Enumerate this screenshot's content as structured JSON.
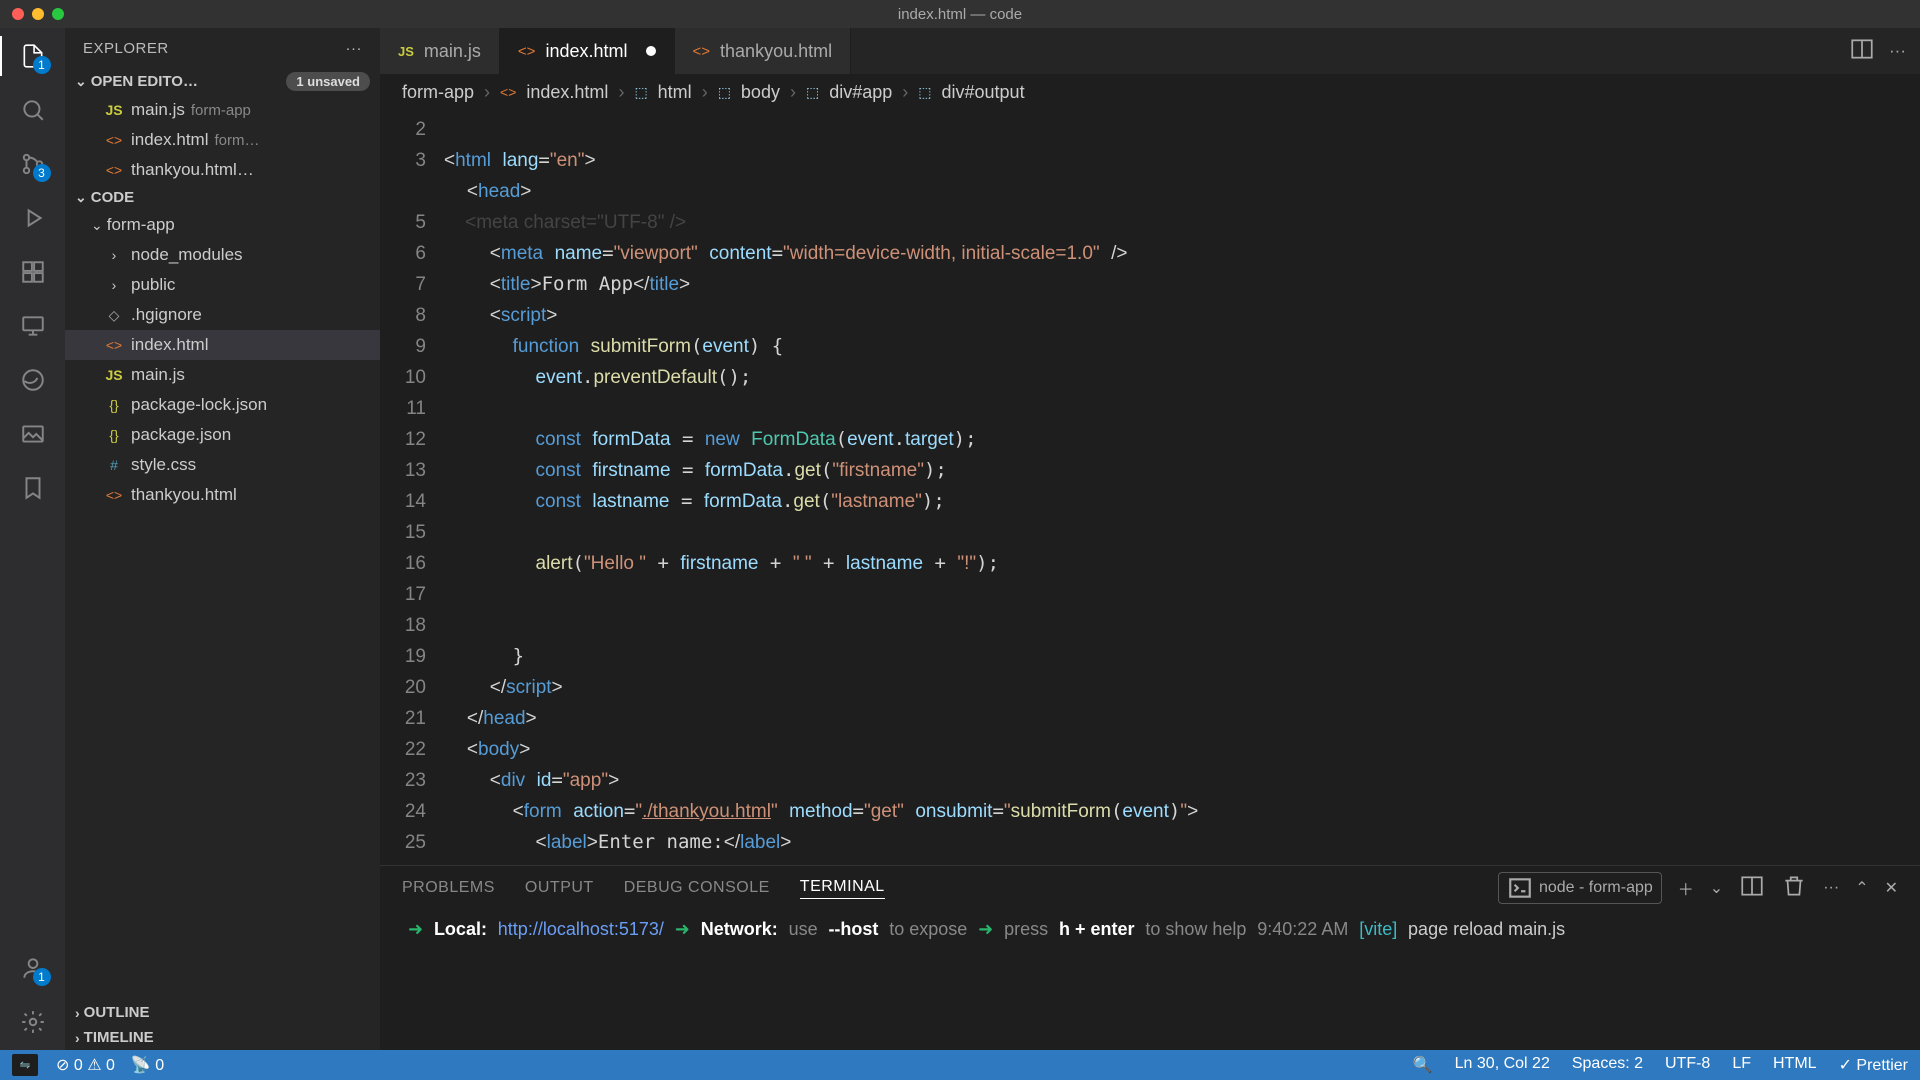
{
  "window_title": "index.html — code",
  "explorer": {
    "title": "EXPLORER"
  },
  "open_editors": {
    "title": "OPEN EDITO…",
    "unsaved": "1 unsaved",
    "items": [
      {
        "icon": "JS",
        "name": "main.js",
        "folder": "form-app",
        "modified": false
      },
      {
        "icon": "<>",
        "name": "index.html",
        "folder": "form…",
        "modified": true
      },
      {
        "icon": "<>",
        "name": "thankyou.html…",
        "folder": "",
        "modified": false
      }
    ]
  },
  "workspace": {
    "title": "CODE",
    "root": "form-app",
    "nodes": [
      {
        "icon": ">",
        "name": "node_modules"
      },
      {
        "icon": ">",
        "name": "public"
      },
      {
        "icon": "◇",
        "name": ".hgignore"
      },
      {
        "icon": "<>",
        "name": "index.html",
        "selected": true
      },
      {
        "icon": "JS",
        "name": "main.js"
      },
      {
        "icon": "{}",
        "name": "package-lock.json"
      },
      {
        "icon": "{}",
        "name": "package.json"
      },
      {
        "icon": "#",
        "name": "style.css"
      },
      {
        "icon": "<>",
        "name": "thankyou.html"
      }
    ]
  },
  "outline": "OUTLINE",
  "timeline": "TIMELINE",
  "tabs": [
    {
      "icon": "JS",
      "label": "main.js",
      "active": false,
      "modified": false
    },
    {
      "icon": "<>",
      "label": "index.html",
      "active": true,
      "modified": true
    },
    {
      "icon": "<>",
      "label": "thankyou.html",
      "active": false,
      "modified": false
    }
  ],
  "breadcrumbs": [
    "form-app",
    "index.html",
    "html",
    "body",
    "div#app",
    "div#output"
  ],
  "gutter_lines": [
    "2",
    "3",
    "",
    "5",
    "6",
    "7",
    "8",
    "9",
    "10",
    "11",
    "12",
    "13",
    "14",
    "15",
    "16",
    "17",
    "18",
    "19",
    "20",
    "21",
    "22",
    "23",
    "24",
    "25"
  ],
  "panel_tabs": [
    "PROBLEMS",
    "OUTPUT",
    "DEBUG CONSOLE",
    "TERMINAL"
  ],
  "terminal_label": "node - form-app",
  "terminal": {
    "l1a": "Local:",
    "l1b": "http://localhost:5173/",
    "l2a": "Network:",
    "l2b": "use",
    "l2c": "--host",
    "l2d": "to expose",
    "l3a": "press",
    "l3b": "h + enter",
    "l3c": "to show help",
    "l4a": "9:40:22 AM",
    "l4b": "[vite]",
    "l4c": "page reload main.js"
  },
  "status": {
    "errors": "0",
    "warnings": "0",
    "ports": "0",
    "cursor": "Ln 30, Col 22",
    "spaces": "Spaces: 2",
    "enc": "UTF-8",
    "eol": "LF",
    "lang": "HTML",
    "fmt": "Prettier"
  },
  "badges": {
    "explorer": "1",
    "scm": "3",
    "accounts": "1"
  }
}
